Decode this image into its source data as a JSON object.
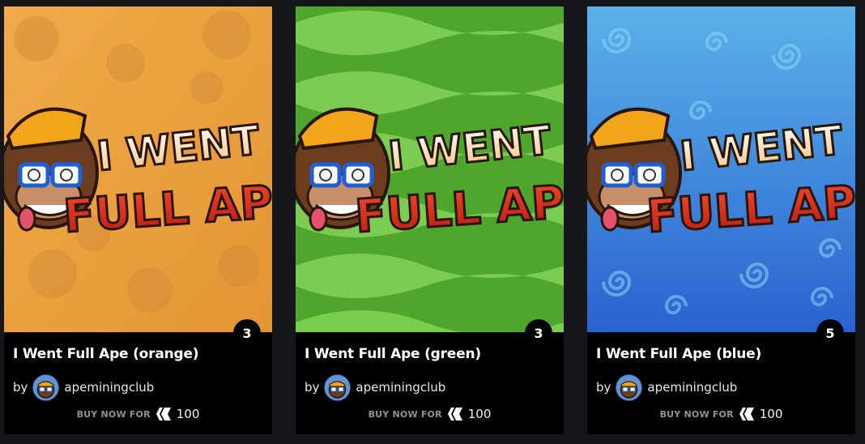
{
  "cards": [
    {
      "title": "I Went Full Ape (orange)",
      "edition": "3",
      "by": "by",
      "creator": "apeminingclub",
      "buy_label": "BUY NOW FOR",
      "price": "100",
      "logo_line1": "I WENT",
      "logo_line2": "FULL APE",
      "bg_color": "#eda240",
      "bg_accent": "#d9862a"
    },
    {
      "title": "I Went Full Ape (green)",
      "edition": "3",
      "by": "by",
      "creator": "apeminingclub",
      "buy_label": "BUY NOW FOR",
      "price": "100",
      "logo_line1": "I WENT",
      "logo_line2": "FULL APE",
      "bg_color": "#5cb833",
      "bg_accent": "#8cdc5e"
    },
    {
      "title": "I Went Full Ape (blue)",
      "edition": "5",
      "by": "by",
      "creator": "apeminingclub",
      "buy_label": "BUY NOW FOR",
      "price": "100",
      "logo_line1": "I WENT",
      "logo_line2": "FULL APE",
      "bg_color": "#3a8ee0",
      "bg_accent": "#6fc0f0"
    }
  ]
}
